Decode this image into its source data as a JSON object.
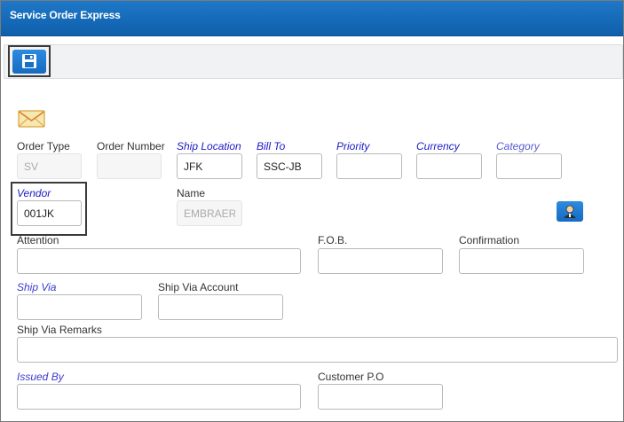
{
  "app": {
    "title": "Service Order Express"
  },
  "toolbar": {
    "save_icon": "floppy-disk-icon"
  },
  "form": {
    "email_icon": "envelope-icon",
    "order_type": {
      "label": "Order Type",
      "value": "SV"
    },
    "order_number": {
      "label": "Order Number",
      "value": ""
    },
    "ship_location": {
      "label": "Ship Location",
      "value": "JFK"
    },
    "bill_to": {
      "label": "Bill To",
      "value": "SSC-JB"
    },
    "priority": {
      "label": "Priority",
      "value": ""
    },
    "currency": {
      "label": "Currency",
      "value": ""
    },
    "category": {
      "label": "Category",
      "value": ""
    },
    "vendor": {
      "label": "Vendor",
      "value": "001JK"
    },
    "name": {
      "label": "Name",
      "value": "EMBRAER-I"
    },
    "vendor_lookup_icon": "user-lookup-icon",
    "attention": {
      "label": "Attention",
      "value": ""
    },
    "fob": {
      "label": "F.O.B.",
      "value": ""
    },
    "confirmation": {
      "label": "Confirmation",
      "value": ""
    },
    "ship_via": {
      "label": "Ship Via",
      "value": ""
    },
    "ship_via_account": {
      "label": "Ship Via Account",
      "value": ""
    },
    "ship_via_remarks": {
      "label": "Ship Via Remarks",
      "value": ""
    },
    "issued_by": {
      "label": "Issued By",
      "value": ""
    },
    "customer_po": {
      "label": "Customer P.O",
      "value": ""
    }
  },
  "colors": {
    "header_blue": "#1565b8",
    "required_label": "#1a1ac8"
  }
}
